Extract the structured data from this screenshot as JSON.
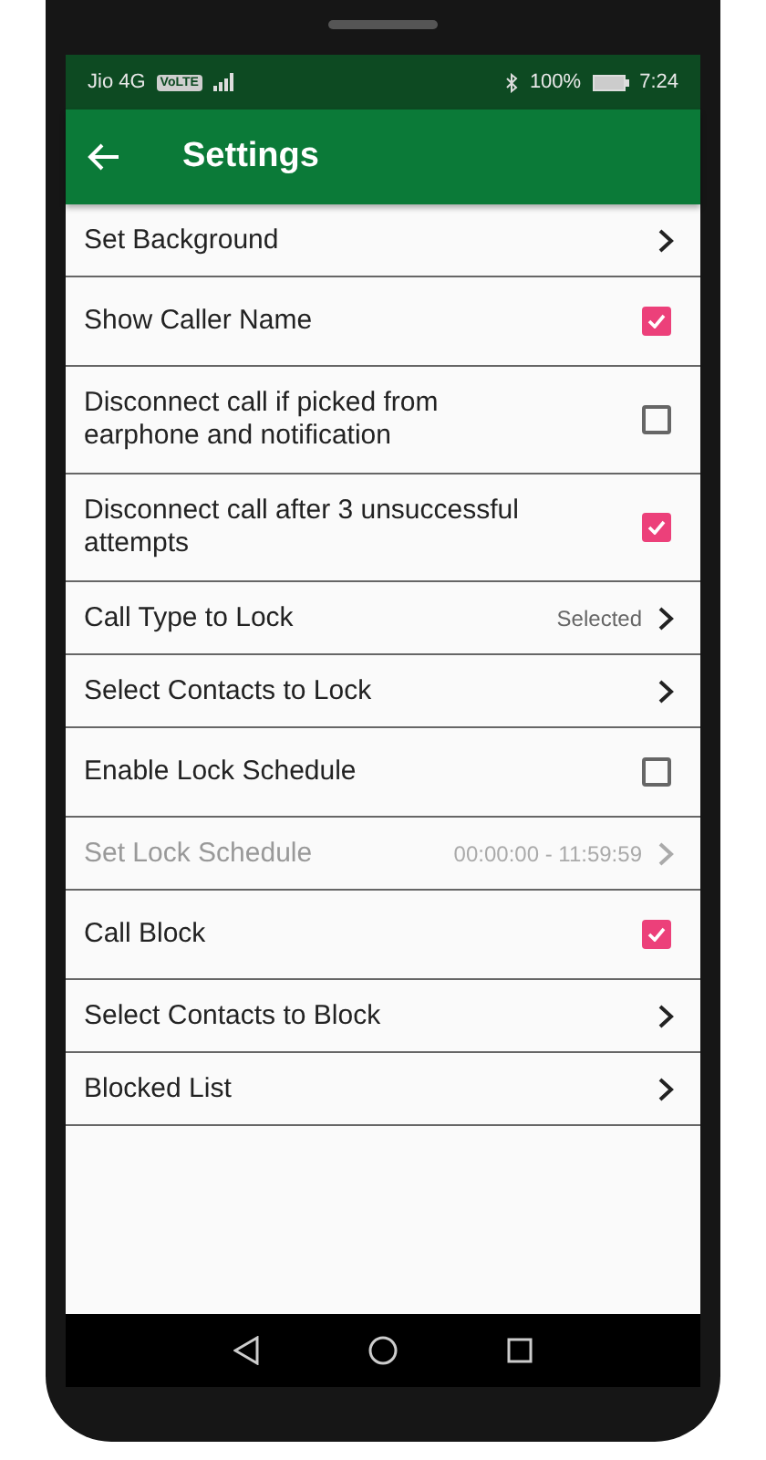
{
  "status_bar": {
    "carrier": "Jio 4G",
    "volte": "VoLTE",
    "battery": "100%",
    "time": "7:24"
  },
  "app_bar": {
    "title": "Settings"
  },
  "items": [
    {
      "kind": "chevron",
      "label": "Set Background",
      "disabled": false
    },
    {
      "kind": "checkbox",
      "label": "Show Caller Name",
      "checked": true,
      "disabled": false
    },
    {
      "kind": "checkbox",
      "label": "Disconnect call if picked from earphone and notification",
      "checked": false,
      "disabled": false
    },
    {
      "kind": "checkbox",
      "label": "Disconnect call after 3 unsuccessful attempts",
      "checked": true,
      "disabled": false
    },
    {
      "kind": "chevron",
      "label": "Call Type to Lock",
      "value": "Selected",
      "disabled": false
    },
    {
      "kind": "chevron",
      "label": "Select Contacts to Lock",
      "disabled": false
    },
    {
      "kind": "checkbox",
      "label": "Enable Lock Schedule",
      "checked": false,
      "disabled": false
    },
    {
      "kind": "chevron",
      "label": "Set Lock Schedule",
      "value": "00:00:00 - 11:59:59",
      "disabled": true
    },
    {
      "kind": "checkbox",
      "label": "Call Block",
      "checked": true,
      "disabled": false
    },
    {
      "kind": "chevron",
      "label": "Select Contacts to Block",
      "disabled": false
    },
    {
      "kind": "chevron",
      "label": "Blocked List",
      "disabled": false
    }
  ]
}
